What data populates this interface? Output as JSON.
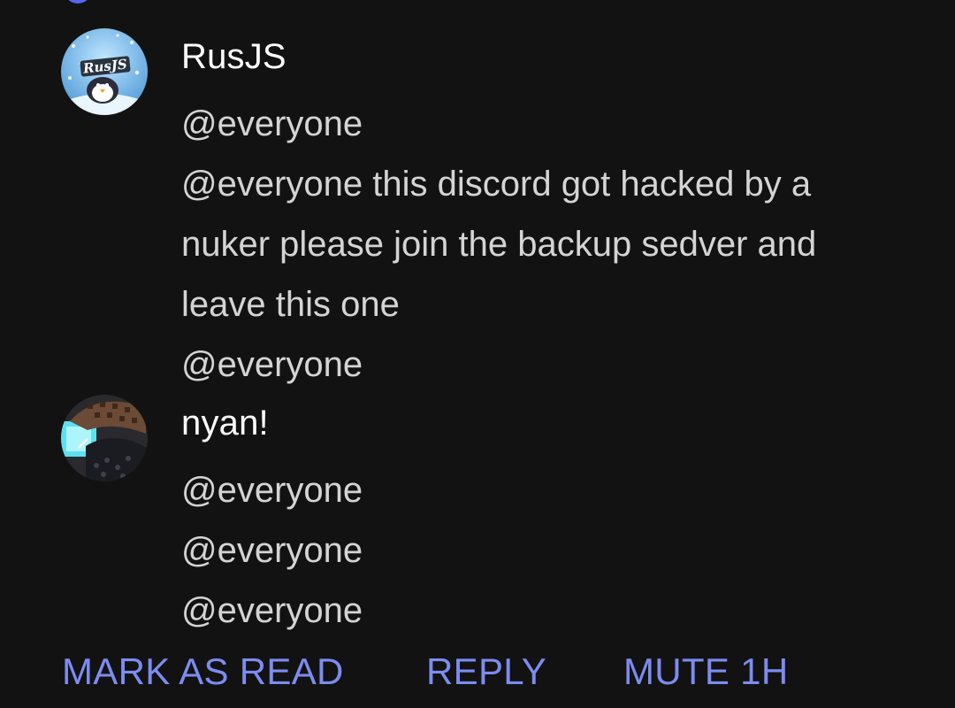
{
  "notification": {
    "messages": [
      {
        "author": "RusJS",
        "avatar_icon": "penguin-snow-avatar-icon",
        "avatar_logo_text": "RusJS",
        "lines": [
          "@everyone",
          "@everyone this discord got hacked by a",
          "nuker please join the backup sedver and",
          "leave this one",
          "@everyone"
        ]
      },
      {
        "author": "nyan!",
        "avatar_icon": "patterned-avatar-icon",
        "lines": [
          "@everyone",
          "@everyone",
          "@everyone"
        ]
      }
    ],
    "actions": {
      "mark_as_read": "MARK AS READ",
      "reply": "REPLY",
      "mute": "MUTE 1H"
    },
    "colors": {
      "background": "#121212",
      "author_text": "#ffffff",
      "body_text": "#d4d4d4",
      "action_text": "#7c8cf0"
    }
  }
}
